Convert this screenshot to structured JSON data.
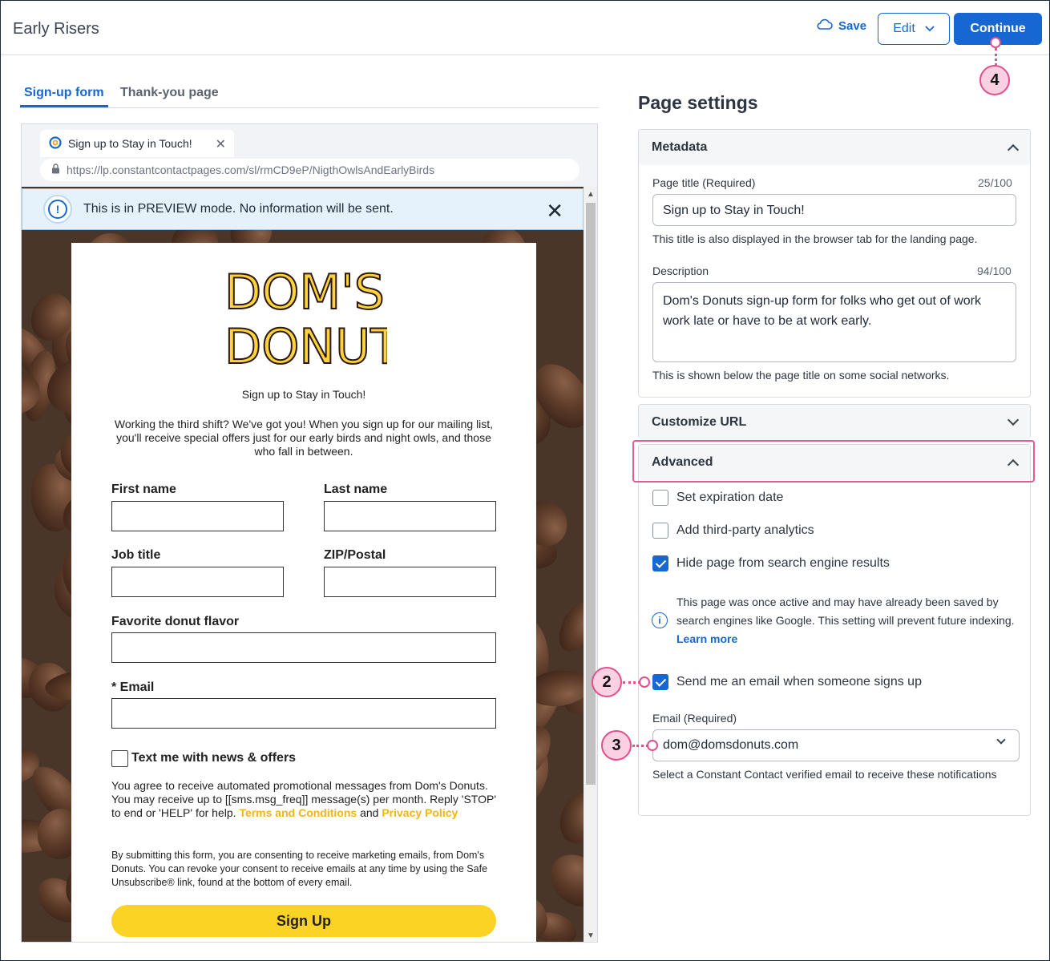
{
  "header": {
    "title": "Early Risers",
    "save_label": "Save",
    "edit_label": "Edit",
    "continue_label": "Continue"
  },
  "tabs": [
    {
      "label": "Sign-up form",
      "active": true
    },
    {
      "label": "Thank-you page",
      "active": false
    }
  ],
  "browser": {
    "tab_title": "Sign up to Stay in Touch!",
    "url": "https://lp.constantcontactpages.com/sl/rmCD9eP/NigthOwlsAndEarlyBirds",
    "preview_message": "This is in PREVIEW mode. No information will be sent."
  },
  "form": {
    "logo_line1": "DOM'S",
    "logo_line2": "DONUTS",
    "heading": "Sign up to Stay in Touch!",
    "intro": "Working the third shift? We've got you! When you sign up for our mailing list, you'll receive special offers just for our early birds and night owls, and those who fall in between.",
    "first_name_label": "First name",
    "last_name_label": "Last name",
    "job_title_label": "Job title",
    "zip_label": "ZIP/Postal",
    "flavor_label": "Favorite donut flavor",
    "email_label": "* Email",
    "sms_label": "Text me with news & offers",
    "sms_text": "You agree to receive automated promotional messages from Dom's Donuts. You may receive up to [[sms.msg_freq]] message(s) per month. Reply 'STOP' to end or 'HELP' for help.",
    "terms_link": "Terms and Conditions",
    "and_text": "and",
    "privacy_link": "Privacy Policy",
    "consent": "By submitting this form, you are consenting to receive marketing emails, from Dom's Donuts. You can revoke your consent to receive emails at any time by using the Safe Unsubscribe® link, found at the bottom of every email.",
    "submit_label": "Sign Up"
  },
  "settings": {
    "title": "Page settings",
    "metadata": {
      "header": "Metadata",
      "page_title_label": "Page title",
      "page_title_required": "(Required)",
      "page_title_counter": "25/100",
      "page_title_value": "Sign up to Stay in Touch!",
      "page_title_hint": "This title is also displayed in the browser tab for the landing page.",
      "description_label": "Description",
      "description_counter": "94/100",
      "description_value": "Dom's Donuts sign-up form for folks who get out of work work late or have to be at work early.",
      "description_hint": "This is shown below the page title on some social networks."
    },
    "customize_url": {
      "header": "Customize URL"
    },
    "advanced": {
      "header": "Advanced",
      "set_expiration": {
        "label": "Set expiration date",
        "checked": false
      },
      "third_party": {
        "label": "Add third-party analytics",
        "checked": false
      },
      "hide_search": {
        "label": "Hide page from search engine results",
        "checked": true
      },
      "info_text": "This page was once active and may have already been saved by search engines like Google. This setting will prevent future indexing.",
      "learn_more": "Learn more",
      "send_email": {
        "label": "Send me an email when someone signs up",
        "checked": true
      },
      "email_label": "Email",
      "email_required": "(Required)",
      "email_value": "dom@domsdonuts.com",
      "email_hint": "Select a Constant Contact verified email to receive these notifications"
    }
  },
  "callouts": {
    "c2": "2",
    "c3": "3",
    "c4": "4"
  },
  "colors": {
    "primary": "#1767d2",
    "callout": "#e0508c",
    "button_yellow": "#fbd325"
  }
}
